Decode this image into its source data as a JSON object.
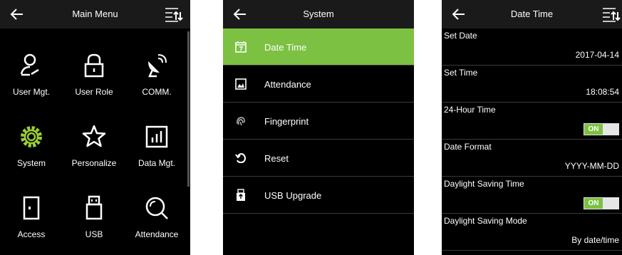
{
  "main_menu": {
    "title": "Main Menu",
    "items": [
      {
        "label": "User Mgt.",
        "icon": "user-mgt-icon"
      },
      {
        "label": "User Role",
        "icon": "lock-icon"
      },
      {
        "label": "COMM.",
        "icon": "satellite-dish-icon"
      },
      {
        "label": "System",
        "icon": "gear-icon"
      },
      {
        "label": "Personalize",
        "icon": "star-icon"
      },
      {
        "label": "Data Mgt.",
        "icon": "bar-chart-icon"
      },
      {
        "label": "Access",
        "icon": "door-icon"
      },
      {
        "label": "USB",
        "icon": "usb-drive-icon"
      },
      {
        "label": "Attendance",
        "icon": "magnifier-icon"
      }
    ]
  },
  "system_menu": {
    "title": "System",
    "items": [
      {
        "label": "Date Time",
        "icon": "calendar-icon",
        "active": true
      },
      {
        "label": "Attendance",
        "icon": "attendance-icon",
        "active": false
      },
      {
        "label": "Fingerprint",
        "icon": "fingerprint-icon",
        "active": false
      },
      {
        "label": "Reset",
        "icon": "reset-icon",
        "active": false
      },
      {
        "label": "USB Upgrade",
        "icon": "usb-upgrade-icon",
        "active": false
      }
    ]
  },
  "date_time": {
    "title": "Date Time",
    "rows": [
      {
        "label": "Set Date",
        "value": "2017-04-14"
      },
      {
        "label": "Set Time",
        "value": "18:08:54"
      },
      {
        "label": "24-Hour Time",
        "toggle": "ON"
      },
      {
        "label": "Date Format",
        "value": "YYYY-MM-DD"
      },
      {
        "label": "Daylight Saving Time",
        "toggle": "ON"
      },
      {
        "label": "Daylight Saving Mode",
        "value": "By date/time"
      }
    ]
  },
  "colors": {
    "accent": "#7cc142",
    "background": "#000000",
    "header": "#1a1a1a",
    "icon_active": "#9acd32"
  }
}
